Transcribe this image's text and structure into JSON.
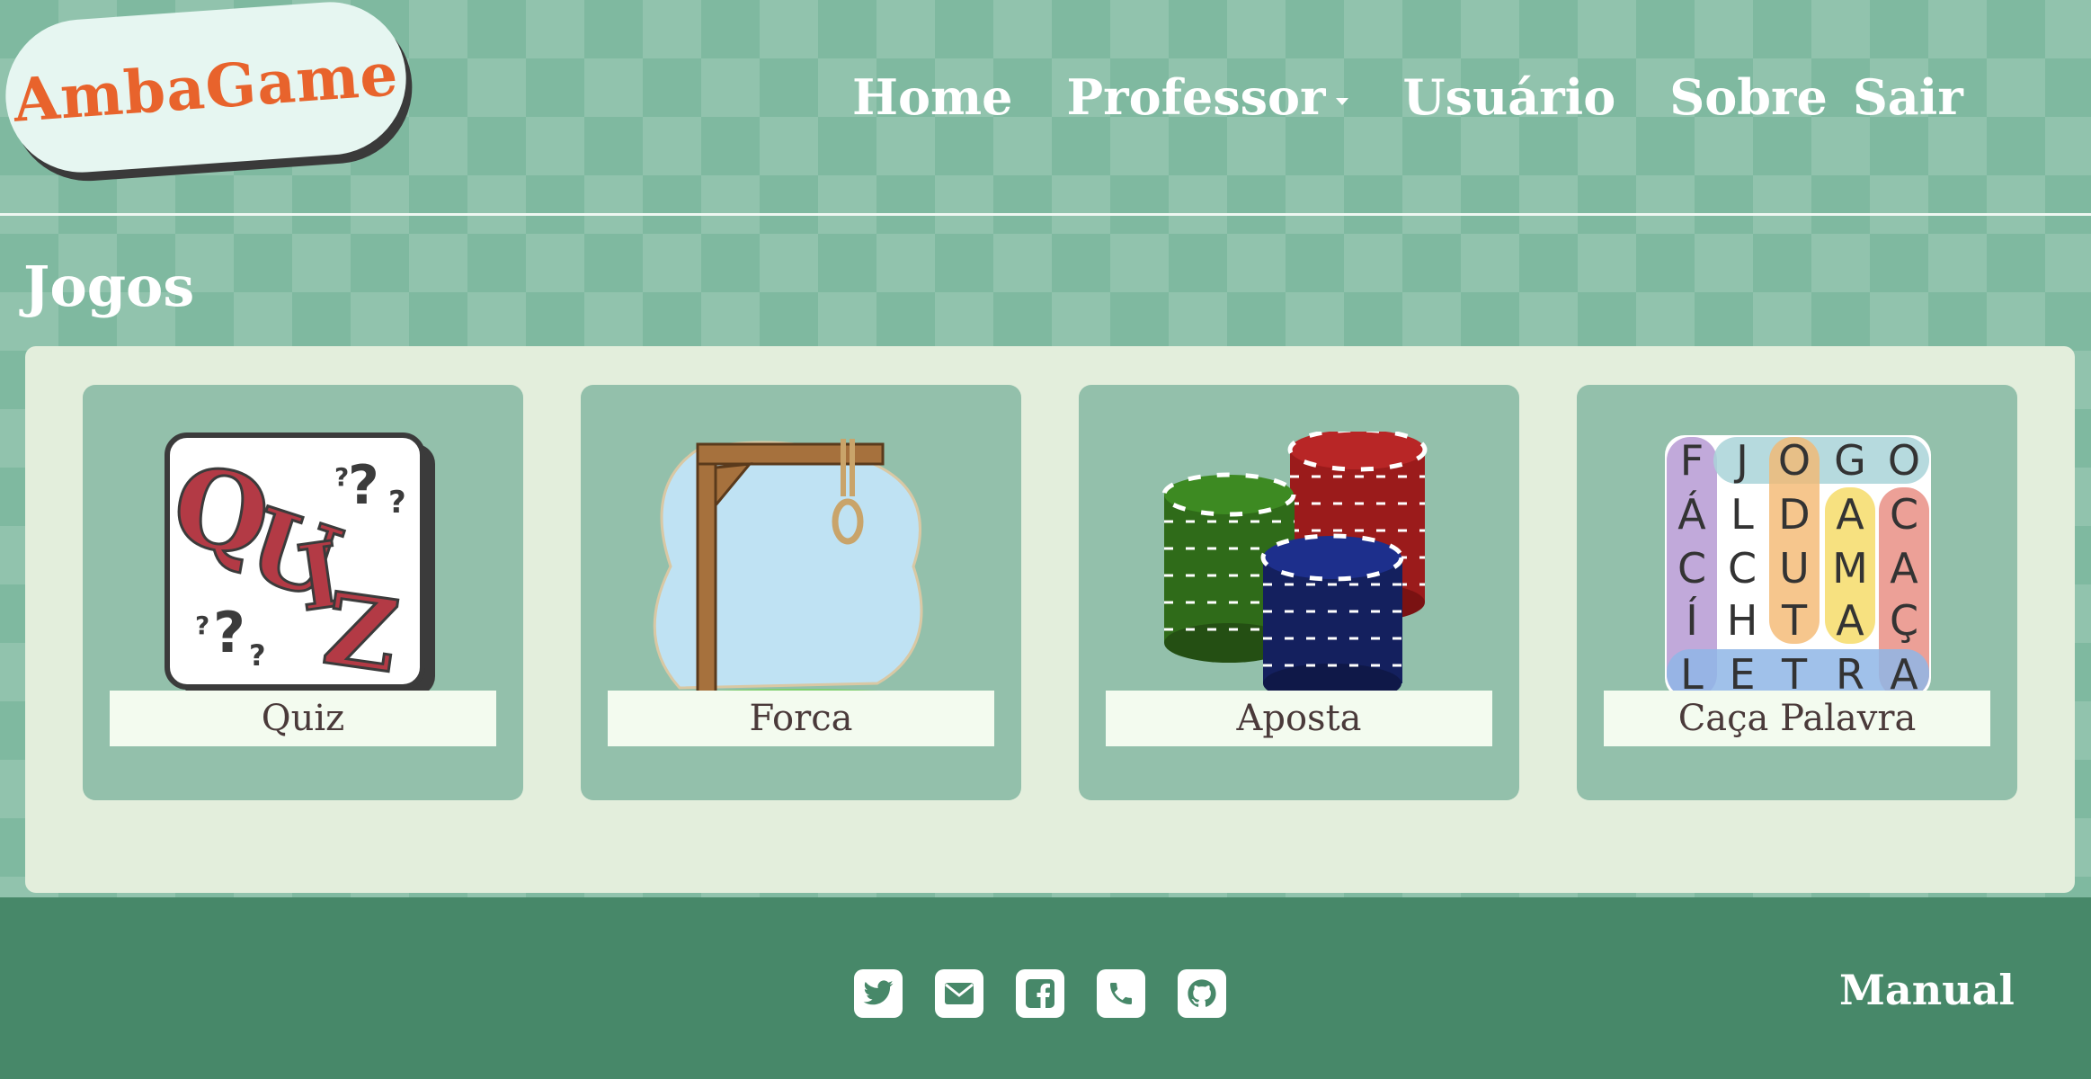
{
  "header": {
    "logo": "AmbaGame",
    "nav": [
      {
        "label": "Home"
      },
      {
        "label": "Professor"
      },
      {
        "label": "Usuário"
      },
      {
        "label": "Sobre"
      },
      {
        "label": "Sair"
      }
    ]
  },
  "main": {
    "title": "Jogos",
    "games": [
      {
        "label": "Quiz",
        "image": "quiz-icon"
      },
      {
        "label": "Forca",
        "image": "hangman-icon"
      },
      {
        "label": "Aposta",
        "image": "poker-chips-icon"
      },
      {
        "label": "Caça Palavra",
        "image": "word-search-icon"
      }
    ]
  },
  "footer": {
    "social": [
      "twitter-icon",
      "email-icon",
      "facebook-icon",
      "phone-icon",
      "github-icon"
    ],
    "manual": "Manual"
  },
  "colors": {
    "background": "#7fb9a0",
    "panel": "#e3eedc",
    "card": "#93c0ab",
    "footer": "#478869",
    "logo_text": "#e8632c"
  }
}
